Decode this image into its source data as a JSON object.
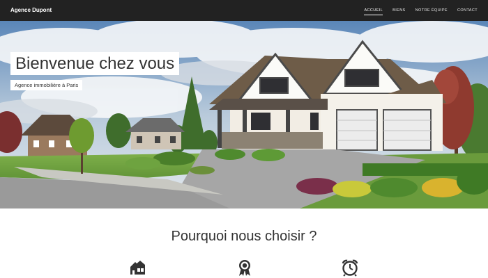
{
  "header": {
    "brand": "Agence Dupont",
    "nav": [
      {
        "label": "ACCUEIL",
        "active": true
      },
      {
        "label": "BIENS",
        "active": false
      },
      {
        "label": "NOTRE ÉQUIPE",
        "active": false
      },
      {
        "label": "CONTACT",
        "active": false
      }
    ]
  },
  "hero": {
    "title": "Bienvenue chez vous",
    "subtitle": "Agence immobilière à Paris",
    "image": "suburban-house-photo"
  },
  "features": {
    "title": "Pourquoi nous choisir ?",
    "icons": [
      "house-icon",
      "award-ribbon-icon",
      "alarm-clock-icon"
    ]
  },
  "colors": {
    "navbar_bg": "#222222",
    "text": "#333333",
    "icon": "#333333"
  }
}
